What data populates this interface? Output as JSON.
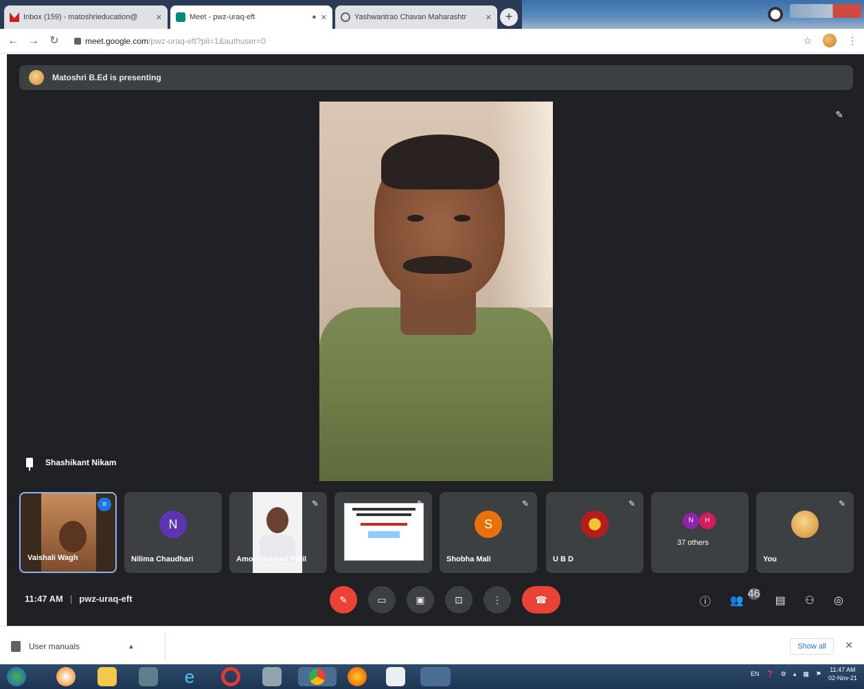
{
  "browser": {
    "tabs": [
      {
        "title": "Inbox (159) - matoshrieducation@",
        "favicon": "gmail-icon",
        "active": false
      },
      {
        "title": "Meet - pwz-uraq-eft",
        "favicon": "meet-icon",
        "active": true
      },
      {
        "title": "Yashwantrao Chavan Maharashtr",
        "favicon": "web-icon",
        "active": false
      }
    ],
    "address": {
      "host": "meet.google.com",
      "path": "/pwz-uraq-eft?pli=1&authuser=0"
    }
  },
  "meet": {
    "presenting_text": "Matoshri B.Ed is presenting",
    "main_speaker": "Shashikant Nikam",
    "tiles": [
      {
        "name": "Vaishali Wagh",
        "type": "video",
        "speaking": true
      },
      {
        "name": "Nilima Chaudhari",
        "type": "letter",
        "letter": "N",
        "color": "#5e35b1"
      },
      {
        "name": "Amol Gaikwad Patil",
        "type": "photo"
      },
      {
        "name": "",
        "type": "poster"
      },
      {
        "name": "Shobha Mali",
        "type": "letter",
        "letter": "S",
        "color": "#e8710a"
      },
      {
        "name": "U B D",
        "type": "emblem"
      },
      {
        "name": "37 others",
        "type": "others",
        "letters": [
          "N",
          "H"
        ]
      },
      {
        "name": "You",
        "type": "avatar"
      }
    ],
    "time": "11:47 AM",
    "separator": "|",
    "meeting_code": "pwz-uraq-eft",
    "participants_count": "46"
  },
  "downloads": {
    "file": "User manuals",
    "show_all": "Show all"
  },
  "taskbar": {
    "lang": "EN",
    "time": "11:47 AM",
    "date": "02-Nov-21"
  }
}
